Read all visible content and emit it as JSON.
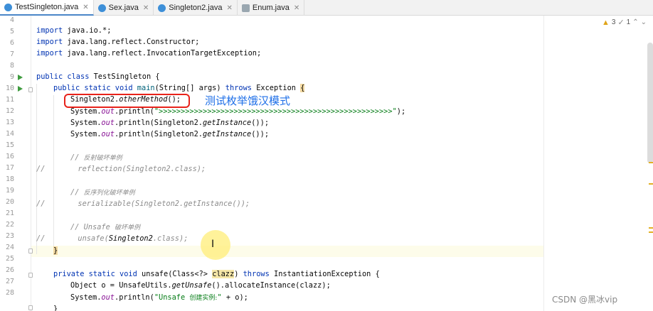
{
  "tabs": [
    {
      "label": "TestSingleton.java",
      "icon": "java-class-icon",
      "active": true
    },
    {
      "label": "Sex.java",
      "icon": "java-class-icon",
      "active": false
    },
    {
      "label": "Singleton2.java",
      "icon": "java-class-icon",
      "active": false
    },
    {
      "label": "Enum.java",
      "icon": "enum-icon",
      "active": false
    }
  ],
  "inspections": {
    "warning_count": "3",
    "hint_count": "1"
  },
  "line_numbers": [
    "4",
    "5",
    "6",
    "7",
    "8",
    "9",
    "10",
    "11",
    "12",
    "13",
    "14",
    "15",
    "16",
    "17",
    "18",
    "19",
    "20",
    "21",
    "22",
    "23",
    "24",
    "25",
    "26",
    "27",
    "28"
  ],
  "code": {
    "l6_kw": "import",
    "l6_rest": " java.io.*;",
    "l7_kw": "import",
    "l7_rest": " java.lang.reflect.Constructor;",
    "l8_kw": "import",
    "l8_rest": " java.lang.reflect.InvocationTargetException;",
    "l10_kw": "public class",
    "l10_rest": " TestSingleton {",
    "l11_kw1": "public static void",
    "l11_name": " main",
    "l11_mid": "(String[] args) ",
    "l11_kw2": "throws",
    "l11_rest": " Exception ",
    "l11_brace": "{",
    "l12_a": "Singleton2.",
    "l12_method": "otherMethod",
    "l12_b": "();",
    "l13_a": "System.",
    "l13_fld": "out",
    "l13_b": ".println(",
    "l13_str": "\">>>>>>>>>>>>>>>>>>>>>>>>>>>>>>>>>>>>>>>>>>>>>>>>>>>>>\"",
    "l13_c": ");",
    "l14_a": "System.",
    "l14_fld": "out",
    "l14_b": ".println(Singleton2.",
    "l14_m": "getInstance",
    "l14_c": "());",
    "l15_a": "System.",
    "l15_fld": "out",
    "l15_b": ".println(Singleton2.",
    "l15_m": "getInstance",
    "l15_c": "());",
    "l17_prefix": "// ",
    "l17_zh": "反射破坏单例",
    "l18_prefix": "//",
    "l18_code": "reflection(Singleton2.class);",
    "l20_prefix": "// ",
    "l20_zh": "反序列化破坏单例",
    "l21_prefix": "//",
    "l21_code": "serializable(Singleton2.getInstance());",
    "l23_prefix": "// Unsafe ",
    "l23_zh": "破坏单例",
    "l24_prefix": "//",
    "l24_a": "unsafe(",
    "l24_b": "Singleton2",
    "l24_c": ".class);",
    "l25_brace": "}",
    "l27_kw": "private static void",
    "l27_a": " unsafe(Class<?> ",
    "l27_param": "clazz",
    "l27_b": ") ",
    "l27_kw2": "throws",
    "l27_c": " InstantiationException {",
    "l28_a": "Object o = UnsafeUtils.",
    "l28_m": "getUnsafe",
    "l28_b": "().allocateInstance(clazz);",
    "l29_a": "System.",
    "l29_fld": "out",
    "l29_b": ".println(",
    "l29_str1": "\"Unsafe ",
    "l29_zh": "创建实例:",
    "l29_str2": "\"",
    "l29_c": " + o);",
    "l30_brace": "}"
  },
  "annotation_text": "测试枚举饿汉模式",
  "watermark": "CSDN @黑冰vip",
  "colors": {
    "keyword": "#0033b3",
    "string": "#067d17",
    "field": "#871094",
    "comment": "#8c8c8c",
    "annotation_box": "#e8221a",
    "annotation_text": "#1e6fe8"
  }
}
